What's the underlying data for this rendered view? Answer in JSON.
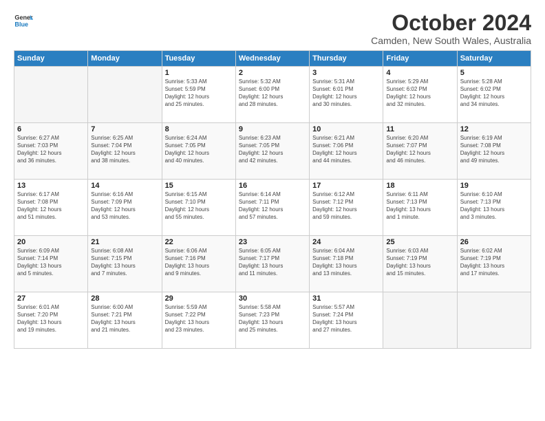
{
  "header": {
    "logo_line1": "General",
    "logo_line2": "Blue",
    "title": "October 2024",
    "subtitle": "Camden, New South Wales, Australia"
  },
  "days_of_week": [
    "Sunday",
    "Monday",
    "Tuesday",
    "Wednesday",
    "Thursday",
    "Friday",
    "Saturday"
  ],
  "weeks": [
    [
      {
        "num": "",
        "info": ""
      },
      {
        "num": "",
        "info": ""
      },
      {
        "num": "1",
        "info": "Sunrise: 5:33 AM\nSunset: 5:59 PM\nDaylight: 12 hours\nand 25 minutes."
      },
      {
        "num": "2",
        "info": "Sunrise: 5:32 AM\nSunset: 6:00 PM\nDaylight: 12 hours\nand 28 minutes."
      },
      {
        "num": "3",
        "info": "Sunrise: 5:31 AM\nSunset: 6:01 PM\nDaylight: 12 hours\nand 30 minutes."
      },
      {
        "num": "4",
        "info": "Sunrise: 5:29 AM\nSunset: 6:02 PM\nDaylight: 12 hours\nand 32 minutes."
      },
      {
        "num": "5",
        "info": "Sunrise: 5:28 AM\nSunset: 6:02 PM\nDaylight: 12 hours\nand 34 minutes."
      }
    ],
    [
      {
        "num": "6",
        "info": "Sunrise: 6:27 AM\nSunset: 7:03 PM\nDaylight: 12 hours\nand 36 minutes."
      },
      {
        "num": "7",
        "info": "Sunrise: 6:25 AM\nSunset: 7:04 PM\nDaylight: 12 hours\nand 38 minutes."
      },
      {
        "num": "8",
        "info": "Sunrise: 6:24 AM\nSunset: 7:05 PM\nDaylight: 12 hours\nand 40 minutes."
      },
      {
        "num": "9",
        "info": "Sunrise: 6:23 AM\nSunset: 7:05 PM\nDaylight: 12 hours\nand 42 minutes."
      },
      {
        "num": "10",
        "info": "Sunrise: 6:21 AM\nSunset: 7:06 PM\nDaylight: 12 hours\nand 44 minutes."
      },
      {
        "num": "11",
        "info": "Sunrise: 6:20 AM\nSunset: 7:07 PM\nDaylight: 12 hours\nand 46 minutes."
      },
      {
        "num": "12",
        "info": "Sunrise: 6:19 AM\nSunset: 7:08 PM\nDaylight: 12 hours\nand 49 minutes."
      }
    ],
    [
      {
        "num": "13",
        "info": "Sunrise: 6:17 AM\nSunset: 7:08 PM\nDaylight: 12 hours\nand 51 minutes."
      },
      {
        "num": "14",
        "info": "Sunrise: 6:16 AM\nSunset: 7:09 PM\nDaylight: 12 hours\nand 53 minutes."
      },
      {
        "num": "15",
        "info": "Sunrise: 6:15 AM\nSunset: 7:10 PM\nDaylight: 12 hours\nand 55 minutes."
      },
      {
        "num": "16",
        "info": "Sunrise: 6:14 AM\nSunset: 7:11 PM\nDaylight: 12 hours\nand 57 minutes."
      },
      {
        "num": "17",
        "info": "Sunrise: 6:12 AM\nSunset: 7:12 PM\nDaylight: 12 hours\nand 59 minutes."
      },
      {
        "num": "18",
        "info": "Sunrise: 6:11 AM\nSunset: 7:13 PM\nDaylight: 13 hours\nand 1 minute."
      },
      {
        "num": "19",
        "info": "Sunrise: 6:10 AM\nSunset: 7:13 PM\nDaylight: 13 hours\nand 3 minutes."
      }
    ],
    [
      {
        "num": "20",
        "info": "Sunrise: 6:09 AM\nSunset: 7:14 PM\nDaylight: 13 hours\nand 5 minutes."
      },
      {
        "num": "21",
        "info": "Sunrise: 6:08 AM\nSunset: 7:15 PM\nDaylight: 13 hours\nand 7 minutes."
      },
      {
        "num": "22",
        "info": "Sunrise: 6:06 AM\nSunset: 7:16 PM\nDaylight: 13 hours\nand 9 minutes."
      },
      {
        "num": "23",
        "info": "Sunrise: 6:05 AM\nSunset: 7:17 PM\nDaylight: 13 hours\nand 11 minutes."
      },
      {
        "num": "24",
        "info": "Sunrise: 6:04 AM\nSunset: 7:18 PM\nDaylight: 13 hours\nand 13 minutes."
      },
      {
        "num": "25",
        "info": "Sunrise: 6:03 AM\nSunset: 7:19 PM\nDaylight: 13 hours\nand 15 minutes."
      },
      {
        "num": "26",
        "info": "Sunrise: 6:02 AM\nSunset: 7:19 PM\nDaylight: 13 hours\nand 17 minutes."
      }
    ],
    [
      {
        "num": "27",
        "info": "Sunrise: 6:01 AM\nSunset: 7:20 PM\nDaylight: 13 hours\nand 19 minutes."
      },
      {
        "num": "28",
        "info": "Sunrise: 6:00 AM\nSunset: 7:21 PM\nDaylight: 13 hours\nand 21 minutes."
      },
      {
        "num": "29",
        "info": "Sunrise: 5:59 AM\nSunset: 7:22 PM\nDaylight: 13 hours\nand 23 minutes."
      },
      {
        "num": "30",
        "info": "Sunrise: 5:58 AM\nSunset: 7:23 PM\nDaylight: 13 hours\nand 25 minutes."
      },
      {
        "num": "31",
        "info": "Sunrise: 5:57 AM\nSunset: 7:24 PM\nDaylight: 13 hours\nand 27 minutes."
      },
      {
        "num": "",
        "info": ""
      },
      {
        "num": "",
        "info": ""
      }
    ]
  ]
}
